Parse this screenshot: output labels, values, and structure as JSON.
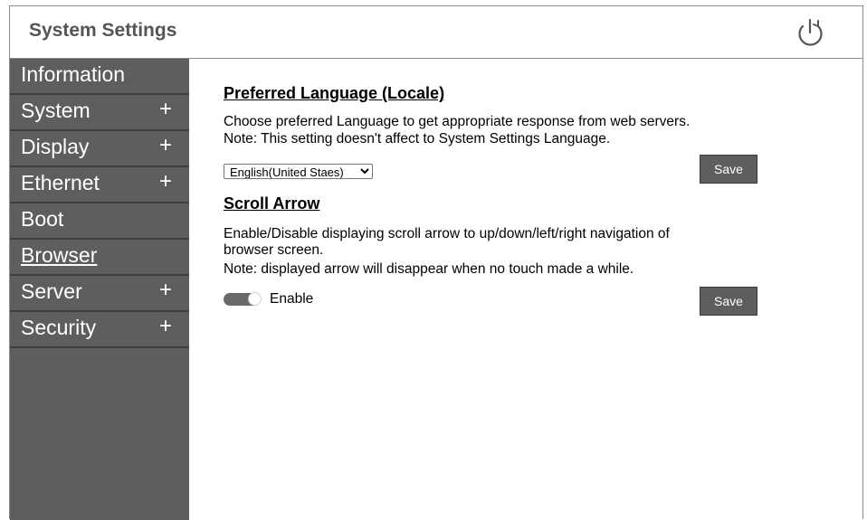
{
  "header": {
    "title": "System Settings",
    "power_icon": "power-icon"
  },
  "sidebar": {
    "items": [
      {
        "label": "Information",
        "expandable": false
      },
      {
        "label": "System",
        "expandable": true,
        "expander": "+"
      },
      {
        "label": "Display",
        "expandable": true,
        "expander": "+"
      },
      {
        "label": "Ethernet",
        "expandable": true,
        "expander": "+"
      },
      {
        "label": "Boot",
        "expandable": false
      },
      {
        "label": "Browser",
        "expandable": false,
        "active": true
      },
      {
        "label": "Server",
        "expandable": true,
        "expander": "+"
      },
      {
        "label": "Security",
        "expandable": true,
        "expander": "+"
      }
    ]
  },
  "locale": {
    "title": "Preferred Language (Locale)",
    "desc1": "Choose preferred Language to get appropriate response from web servers.",
    "desc2": "Note: This setting doesn't affect to System Settings Language.",
    "selected": "English(United Staes)",
    "save_label": "Save"
  },
  "scroll": {
    "title": "Scroll Arrow",
    "desc1": "Enable/Disable displaying scroll arrow to up/down/left/right navigation of",
    "desc2": "browser screen.",
    "desc3": "Note: displayed arrow will disappear when no touch made a while.",
    "toggle_label": "Enable",
    "toggle_on": true,
    "save_label": "Save"
  },
  "colors": {
    "sidebar_bg": "#5e5e5e",
    "button_bg": "#5e5e5e",
    "title_gray": "#555555"
  }
}
